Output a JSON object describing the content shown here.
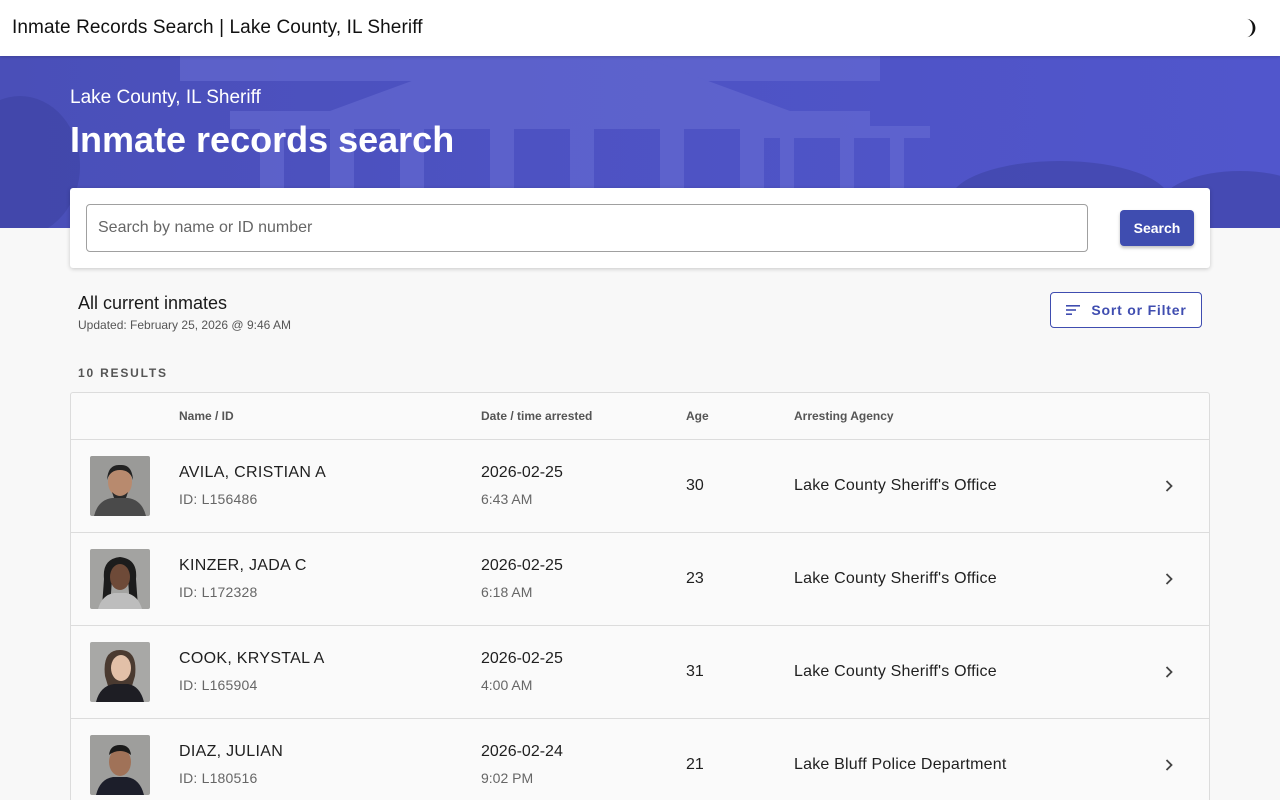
{
  "window": {
    "title": "Inmate Records Search | Lake County, IL Sheriff"
  },
  "header": {
    "theme_icon": "half-moon-icon"
  },
  "hero": {
    "subtitle": "Lake County, IL Sheriff",
    "title": "Inmate records search"
  },
  "search": {
    "placeholder": "Search by name or ID number",
    "value": "",
    "button_label": "Search"
  },
  "list": {
    "heading": "All current inmates",
    "updated": "Updated: February 25, 2026 @ 9:46 AM",
    "filter_label": "Sort or Filter",
    "filter_icon": "sort-lines-icon",
    "results_count": "10 RESULTS"
  },
  "table": {
    "columns": [
      "Name / ID",
      "Date / time arrested",
      "Age",
      "Arresting Agency"
    ],
    "rows": [
      {
        "name": "AVILA, CRISTIAN A",
        "id": "ID: L156486",
        "date": "2026-02-25",
        "time": "6:43 AM",
        "age": "30",
        "agency": "Lake County Sheriff's Office"
      },
      {
        "name": "KINZER, JADA C",
        "id": "ID: L172328",
        "date": "2026-02-25",
        "time": "6:18 AM",
        "age": "23",
        "agency": "Lake County Sheriff's Office"
      },
      {
        "name": "COOK, KRYSTAL A",
        "id": "ID: L165904",
        "date": "2026-02-25",
        "time": "4:00 AM",
        "age": "31",
        "agency": "Lake County Sheriff's Office"
      },
      {
        "name": "DIAZ, JULIAN",
        "id": "ID: L180516",
        "date": "2026-02-24",
        "time": "9:02 PM",
        "age": "21",
        "agency": "Lake Bluff Police Department"
      }
    ]
  },
  "colors": {
    "brand": "#3f4db0",
    "hero": "#4d52c2",
    "background": "#f8f8f8"
  }
}
